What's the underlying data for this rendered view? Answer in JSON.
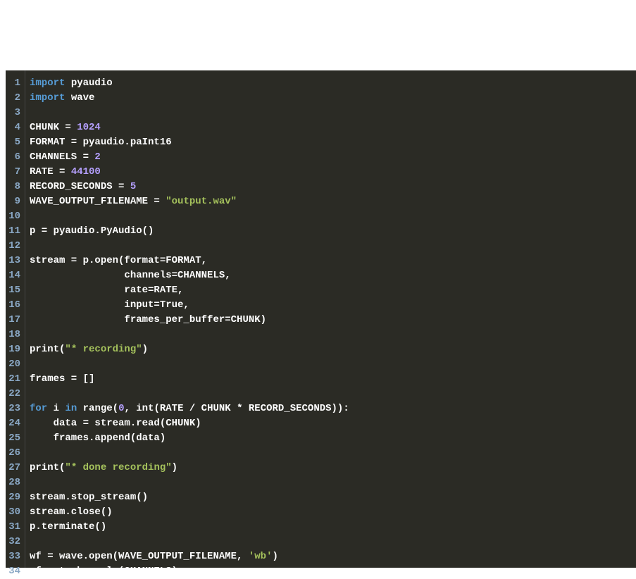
{
  "lines": [
    {
      "ln": 1,
      "tokens": [
        {
          "t": "import",
          "c": "kw"
        },
        {
          "t": " pyaudio",
          "c": "id"
        }
      ]
    },
    {
      "ln": 2,
      "tokens": [
        {
          "t": "import",
          "c": "kw"
        },
        {
          "t": " wave",
          "c": "id"
        }
      ]
    },
    {
      "ln": 3,
      "tokens": []
    },
    {
      "ln": 4,
      "tokens": [
        {
          "t": "CHUNK = ",
          "c": "id"
        },
        {
          "t": "1024",
          "c": "num"
        }
      ]
    },
    {
      "ln": 5,
      "tokens": [
        {
          "t": "FORMAT = pyaudio.paInt16",
          "c": "id"
        }
      ]
    },
    {
      "ln": 6,
      "tokens": [
        {
          "t": "CHANNELS = ",
          "c": "id"
        },
        {
          "t": "2",
          "c": "num"
        }
      ]
    },
    {
      "ln": 7,
      "tokens": [
        {
          "t": "RATE = ",
          "c": "id"
        },
        {
          "t": "44100",
          "c": "num"
        }
      ]
    },
    {
      "ln": 8,
      "tokens": [
        {
          "t": "RECORD_SECONDS = ",
          "c": "id"
        },
        {
          "t": "5",
          "c": "num"
        }
      ]
    },
    {
      "ln": 9,
      "tokens": [
        {
          "t": "WAVE_OUTPUT_FILENAME = ",
          "c": "id"
        },
        {
          "t": "\"output.wav\"",
          "c": "str"
        }
      ]
    },
    {
      "ln": 10,
      "tokens": []
    },
    {
      "ln": 11,
      "tokens": [
        {
          "t": "p = pyaudio.PyAudio()",
          "c": "id"
        }
      ]
    },
    {
      "ln": 12,
      "tokens": []
    },
    {
      "ln": 13,
      "tokens": [
        {
          "t": "stream = p.open(format=FORMAT,",
          "c": "id"
        }
      ]
    },
    {
      "ln": 14,
      "tokens": [
        {
          "t": "                channels=CHANNELS,",
          "c": "id"
        }
      ]
    },
    {
      "ln": 15,
      "tokens": [
        {
          "t": "                rate=RATE,",
          "c": "id"
        }
      ]
    },
    {
      "ln": 16,
      "tokens": [
        {
          "t": "                input=True,",
          "c": "id"
        }
      ]
    },
    {
      "ln": 17,
      "tokens": [
        {
          "t": "                frames_per_buffer=CHUNK)",
          "c": "id"
        }
      ]
    },
    {
      "ln": 18,
      "tokens": []
    },
    {
      "ln": 19,
      "tokens": [
        {
          "t": "print(",
          "c": "id"
        },
        {
          "t": "\"* recording\"",
          "c": "str"
        },
        {
          "t": ")",
          "c": "id"
        }
      ]
    },
    {
      "ln": 20,
      "tokens": []
    },
    {
      "ln": 21,
      "tokens": [
        {
          "t": "frames = []",
          "c": "id"
        }
      ]
    },
    {
      "ln": 22,
      "tokens": []
    },
    {
      "ln": 23,
      "tokens": [
        {
          "t": "for",
          "c": "kw"
        },
        {
          "t": " i ",
          "c": "id"
        },
        {
          "t": "in",
          "c": "kw"
        },
        {
          "t": " range(",
          "c": "id"
        },
        {
          "t": "0",
          "c": "num"
        },
        {
          "t": ", int(RATE / CHUNK * RECORD_SECONDS)):",
          "c": "id"
        }
      ]
    },
    {
      "ln": 24,
      "tokens": [
        {
          "t": "    data = stream.read(CHUNK)",
          "c": "id"
        }
      ]
    },
    {
      "ln": 25,
      "tokens": [
        {
          "t": "    frames.append(data)",
          "c": "id"
        }
      ]
    },
    {
      "ln": 26,
      "tokens": []
    },
    {
      "ln": 27,
      "tokens": [
        {
          "t": "print(",
          "c": "id"
        },
        {
          "t": "\"* done recording\"",
          "c": "str"
        },
        {
          "t": ")",
          "c": "id"
        }
      ]
    },
    {
      "ln": 28,
      "tokens": []
    },
    {
      "ln": 29,
      "tokens": [
        {
          "t": "stream.stop_stream()",
          "c": "id"
        }
      ]
    },
    {
      "ln": 30,
      "tokens": [
        {
          "t": "stream.close()",
          "c": "id"
        }
      ]
    },
    {
      "ln": 31,
      "tokens": [
        {
          "t": "p.terminate()",
          "c": "id"
        }
      ]
    },
    {
      "ln": 32,
      "tokens": []
    },
    {
      "ln": 33,
      "tokens": [
        {
          "t": "wf = wave.open(WAVE_OUTPUT_FILENAME, ",
          "c": "id"
        },
        {
          "t": "'wb'",
          "c": "str"
        },
        {
          "t": ")",
          "c": "id"
        }
      ]
    },
    {
      "ln": 34,
      "tokens": [
        {
          "t": "wf.setnchannels(CHANNELS)",
          "c": "id"
        }
      ]
    }
  ]
}
